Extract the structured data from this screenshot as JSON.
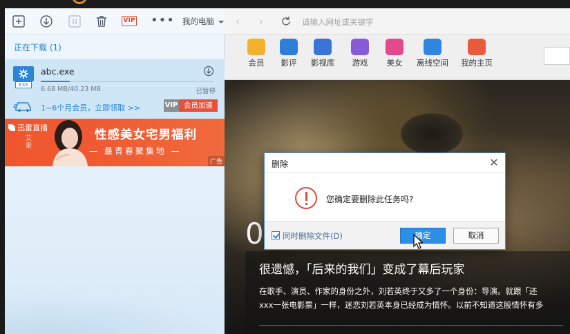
{
  "toolbar": {
    "vip_label": "VIP",
    "more_label": "•••",
    "location_label": "我的电脑"
  },
  "downloads": {
    "section_title": "正在下载 (1)",
    "item": {
      "filename": "abc.exe",
      "file_type": "EXE",
      "size": "6.68 MB/40.23 MB",
      "status": "已暂停",
      "progress": 0.166
    },
    "promo_text": "1~6个月会员，立即领取 >>",
    "vip_tag": "VIP",
    "accelerate_label": "会员加速"
  },
  "ad": {
    "live_label": "迅雷直播",
    "side_text": "艾雷",
    "headline": "性感美女宅男福利",
    "subline": "— 最青春聚集地 —",
    "tag": "广告"
  },
  "browser": {
    "url_placeholder": "请输入网址或关键字",
    "nav_items": [
      {
        "label": "会员",
        "icon": "gift-icon",
        "color": "#f2b12c"
      },
      {
        "label": "影评",
        "icon": "chat-icon",
        "color": "#2f7fd8"
      },
      {
        "label": "影视库",
        "icon": "play-icon",
        "color": "#3b74d6"
      },
      {
        "label": "游戏",
        "icon": "gamepad-icon",
        "color": "#8a5bd6"
      },
      {
        "label": "美女",
        "icon": "mask-icon",
        "color": "#e24a8c"
      },
      {
        "label": "离线空间",
        "icon": "cloud-icon",
        "color": "#2f86e0"
      },
      {
        "label": "我的主页",
        "icon": "home-icon",
        "color": "#ea5a3c"
      }
    ],
    "hero_number": "0",
    "news_title": "很遗憾，「后来的我们」变成了幕后玩家",
    "news_body_1": "在歌手、演员、作家的身份之外，刘若英终于又多了一个身份：导演。就跟「还",
    "news_body_2": "xxx一张电影票」一样，迷恋刘若英本身已经成为情怀。以前不知道这股情怀有多"
  },
  "dialog": {
    "title": "删除",
    "close_label": "✕",
    "message": "您确定要删除此任务吗?",
    "checkbox_label": "同时删除文件(D)",
    "checkbox_checked": true,
    "ok_label": "确定",
    "cancel_label": "取消"
  }
}
